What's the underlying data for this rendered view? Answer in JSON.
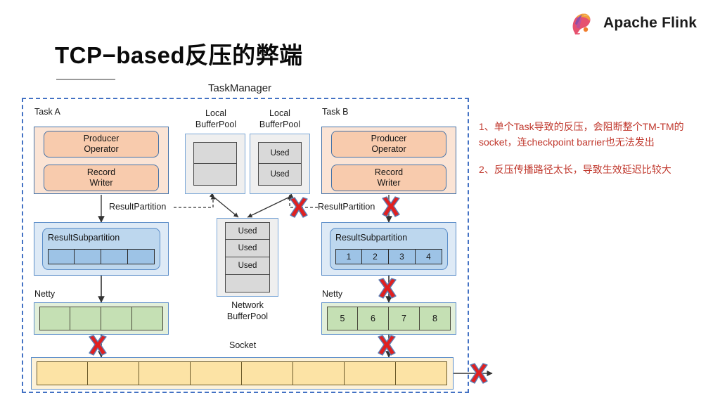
{
  "brand": {
    "name": "Apache Flink",
    "logo_icon": "flink-squirrel-icon",
    "logo_colors": {
      "body": "#E6526F",
      "stripe1": "#F2A03D",
      "stripe2": "#8E4FA8",
      "accent": "#F07C2B"
    }
  },
  "slide": {
    "title": "TCP−based反压的弊端",
    "container_label": "TaskManager"
  },
  "colors": {
    "dashed_border": "#4472C4",
    "task_outer": "#FBE4D5",
    "task_inner": "#F8CBAD",
    "partition_outer": "#DEEAF6",
    "partition_inner": "#BDD7EE",
    "partition_cell": "#9DC3E6",
    "netty_outer": "#E2EFDA",
    "netty_cell": "#C5E0B4",
    "pool_outer": "#EFEFEF",
    "pool_cell": "#D9D9D9",
    "socket_outer": "#FDF2D9",
    "socket_cell": "#FCE3A5",
    "note_red": "#C0372C",
    "cross_red": "#E02020"
  },
  "task_a": {
    "label": "Task A",
    "operator_label": "Producer\nOperator",
    "operator_line1": "Producer",
    "operator_line2": "Operator",
    "writer_line1": "Record",
    "writer_line2": "Writer",
    "result_partition_label": "ResultPartition",
    "subpartition_label": "ResultSubpartition",
    "subpartition_cells": [
      "",
      "",
      "",
      ""
    ],
    "netty_label": "Netty",
    "netty_cells": [
      "",
      "",
      "",
      ""
    ]
  },
  "task_b": {
    "label": "Task B",
    "operator_line1": "Producer",
    "operator_line2": "Operator",
    "writer_line1": "Record",
    "writer_line2": "Writer",
    "result_partition_label": "ResultPartition",
    "subpartition_label": "ResultSubpartition",
    "subpartition_cells": [
      "1",
      "2",
      "3",
      "4"
    ],
    "netty_label": "Netty",
    "netty_cells": [
      "5",
      "6",
      "7",
      "8"
    ]
  },
  "local_pool_left": {
    "label_line1": "Local",
    "label_line2": "BufferPool",
    "slots": [
      "",
      ""
    ]
  },
  "local_pool_right": {
    "label_line1": "Local",
    "label_line2": "BufferPool",
    "slots": [
      "Used",
      "Used"
    ]
  },
  "network_pool": {
    "label_line1": "Network",
    "label_line2": "BufferPool",
    "slots": [
      "Used",
      "Used",
      "Used",
      ""
    ]
  },
  "socket": {
    "label": "Socket",
    "cells": [
      "",
      "",
      "",
      "",
      "",
      "",
      "",
      ""
    ]
  },
  "blockers": {
    "icon": "red-cross-icon",
    "count": 6,
    "positions": [
      "task-a-resultpartition-to-pool",
      "task-b-resultpartition",
      "task-b-netty",
      "task-a-netty-to-socket",
      "task-b-netty-to-socket",
      "socket-egress"
    ]
  },
  "notes": {
    "note1": "1、单个Task导致的反压，会阻断整个TM-TM的socket，连checkpoint barrier也无法发出",
    "note2": "2、反压传播路径太长，导致生效延迟比较大"
  }
}
